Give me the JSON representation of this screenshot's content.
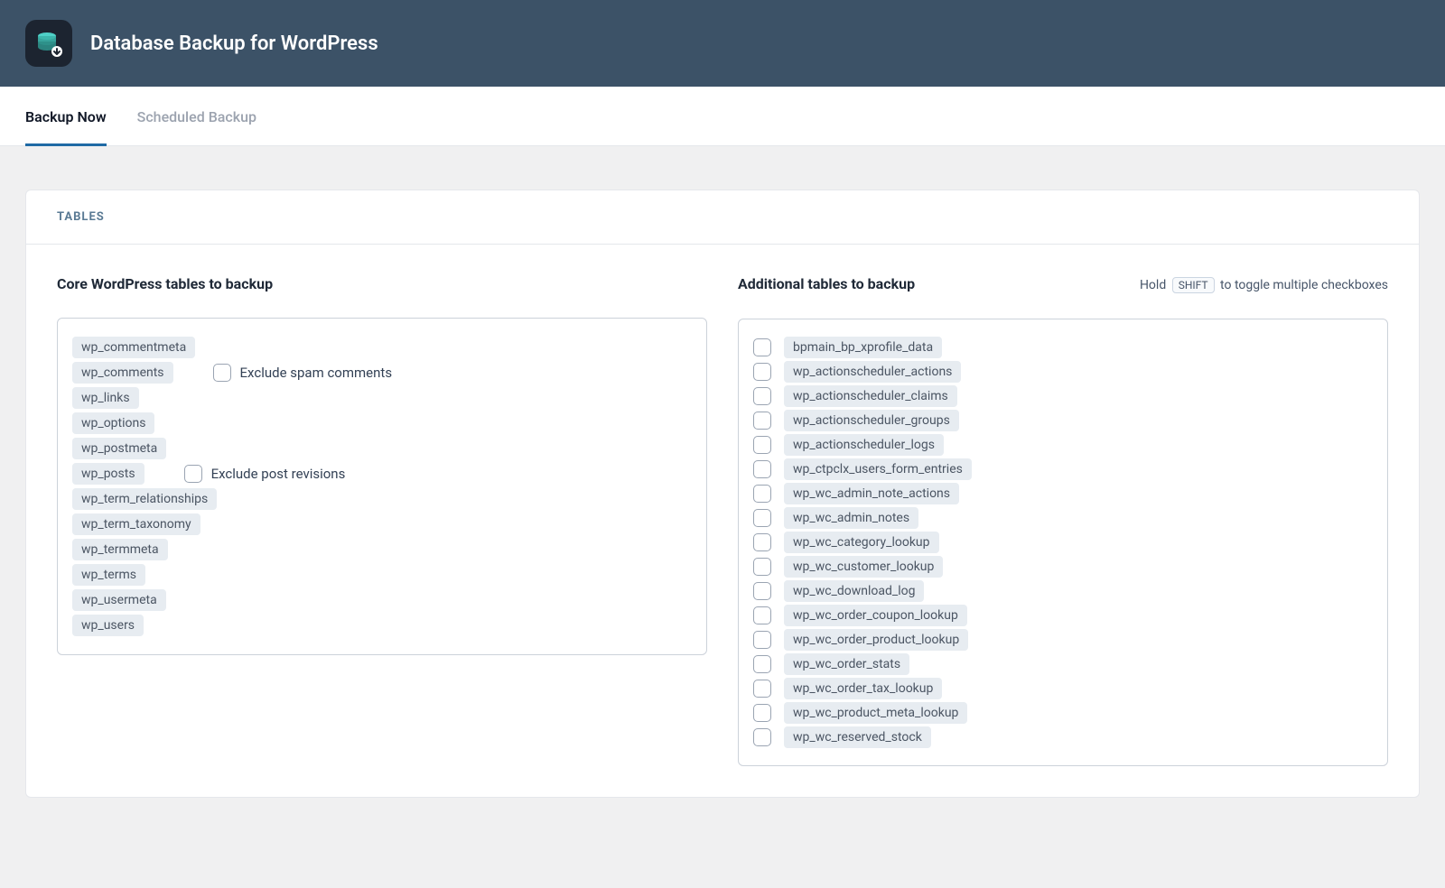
{
  "header": {
    "title": "Database Backup for WordPress"
  },
  "tabs": [
    {
      "label": "Backup Now",
      "active": true
    },
    {
      "label": "Scheduled Backup",
      "active": false
    }
  ],
  "card": {
    "section_label": "TABLES"
  },
  "core": {
    "heading": "Core WordPress tables to backup",
    "tables": [
      {
        "name": "wp_commentmeta"
      },
      {
        "name": "wp_comments",
        "exclude_label": "Exclude spam comments"
      },
      {
        "name": "wp_links"
      },
      {
        "name": "wp_options"
      },
      {
        "name": "wp_postmeta"
      },
      {
        "name": "wp_posts",
        "exclude_label": "Exclude post revisions"
      },
      {
        "name": "wp_term_relationships"
      },
      {
        "name": "wp_term_taxonomy"
      },
      {
        "name": "wp_termmeta"
      },
      {
        "name": "wp_terms"
      },
      {
        "name": "wp_usermeta"
      },
      {
        "name": "wp_users"
      }
    ]
  },
  "additional": {
    "heading": "Additional tables to backup",
    "hint_pre": "Hold",
    "hint_key": "SHIFT",
    "hint_post": "to toggle multiple checkboxes",
    "tables": [
      "bpmain_bp_xprofile_data",
      "wp_actionscheduler_actions",
      "wp_actionscheduler_claims",
      "wp_actionscheduler_groups",
      "wp_actionscheduler_logs",
      "wp_ctpclx_users_form_entries",
      "wp_wc_admin_note_actions",
      "wp_wc_admin_notes",
      "wp_wc_category_lookup",
      "wp_wc_customer_lookup",
      "wp_wc_download_log",
      "wp_wc_order_coupon_lookup",
      "wp_wc_order_product_lookup",
      "wp_wc_order_stats",
      "wp_wc_order_tax_lookup",
      "wp_wc_product_meta_lookup",
      "wp_wc_reserved_stock"
    ]
  }
}
